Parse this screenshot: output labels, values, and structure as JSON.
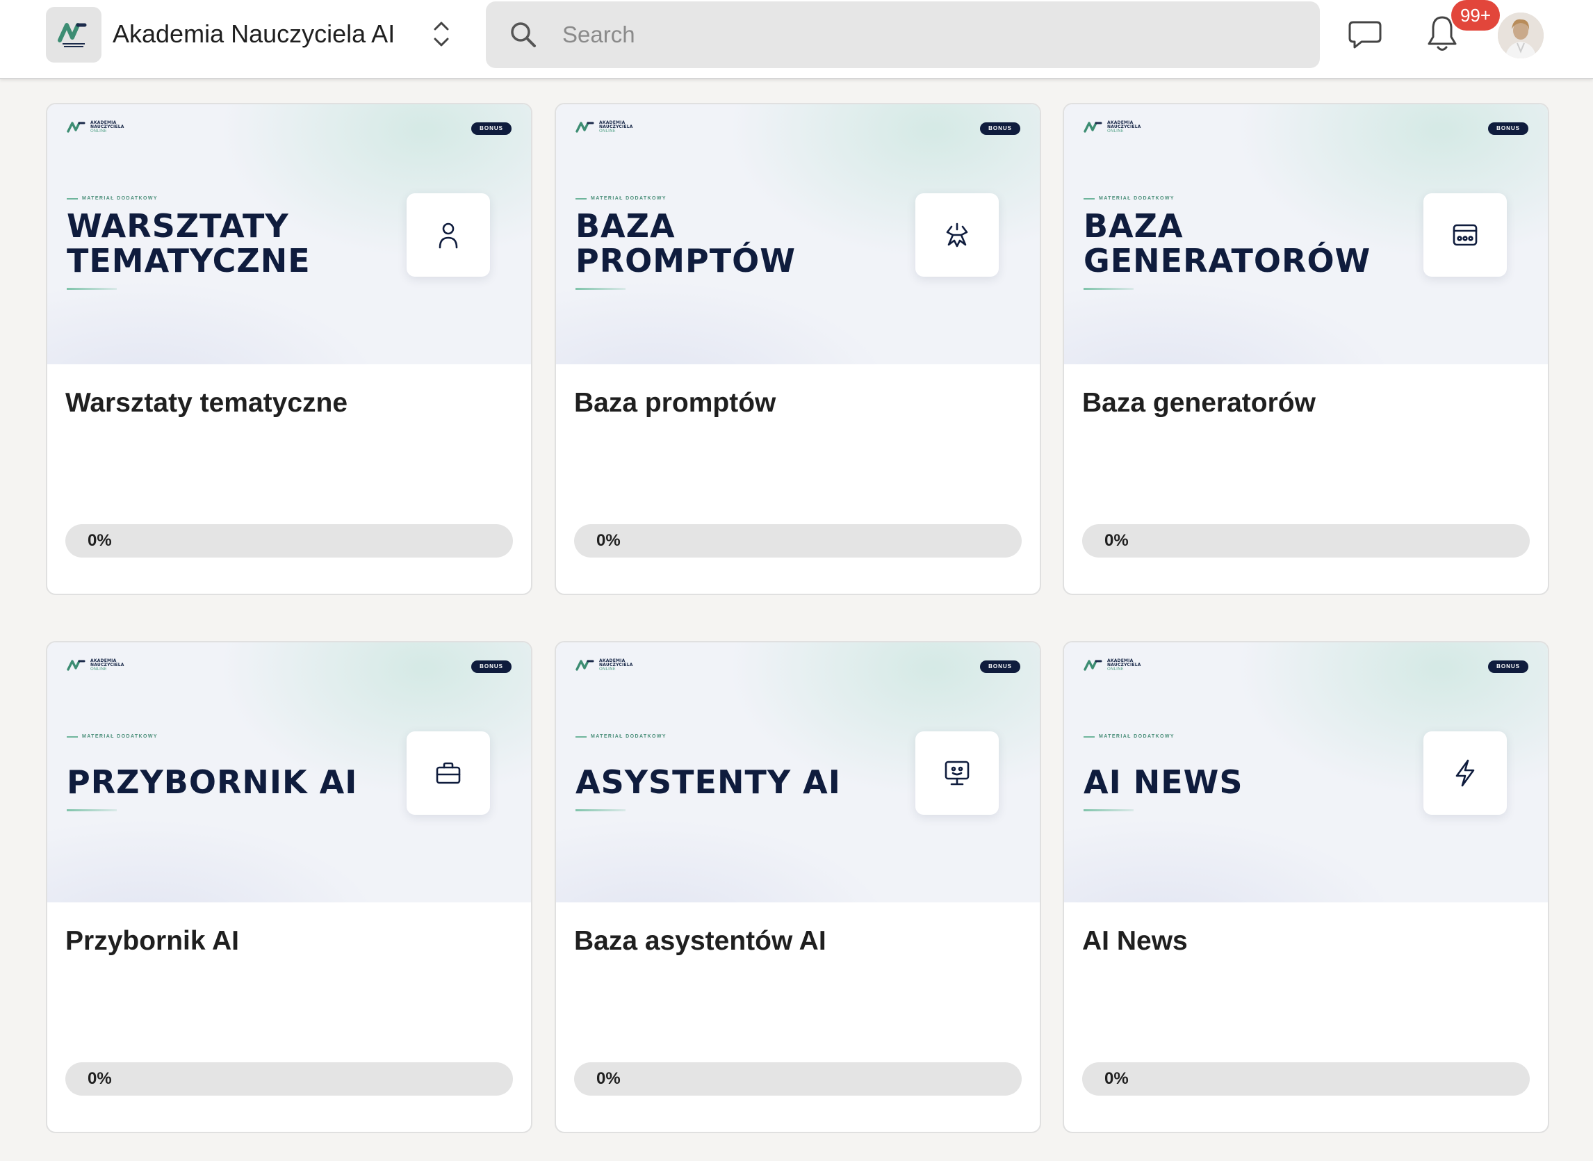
{
  "header": {
    "title": "Akademia Nauczyciela AI",
    "logo_icon": "akademia-logo",
    "switcher_icon": "chevron-up-down-icon",
    "search": {
      "placeholder": "Search",
      "value": ""
    },
    "chat_icon": "chat-bubble-icon",
    "bell_icon": "bell-icon",
    "notification_count": "99+",
    "avatar_icon": "user-avatar"
  },
  "card_common": {
    "logo_text": [
      "AKADEMIA",
      "NAUCZYCIELA",
      "ONLINE"
    ],
    "bonus_label": "BONUS",
    "kicker": "MATERIAŁ DODATKOWY"
  },
  "cards": [
    {
      "banner_title": "WARSZTATY\nTEMATYCZNE",
      "icon": "person-icon",
      "title": "Warsztaty tematyczne",
      "progress": 0,
      "progress_label": "0%"
    },
    {
      "banner_title": "BAZA\nPROMPTÓW",
      "icon": "ai-spark-icon",
      "title": "Baza promptów",
      "progress": 0,
      "progress_label": "0%"
    },
    {
      "banner_title": "BAZA\nGENERATORÓW",
      "icon": "generator-window-icon",
      "title": "Baza generatorów",
      "progress": 0,
      "progress_label": "0%"
    },
    {
      "banner_title": "PRZYBORNIK AI",
      "icon": "briefcase-icon",
      "title": "Przybornik AI",
      "progress": 0,
      "progress_label": "0%"
    },
    {
      "banner_title": "ASYSTENTY AI",
      "icon": "monitor-bot-icon",
      "title": "Baza asystentów AI",
      "progress": 0,
      "progress_label": "0%"
    },
    {
      "banner_title": "AI NEWS",
      "icon": "lightning-icon",
      "title": "AI News",
      "progress": 0,
      "progress_label": "0%"
    }
  ],
  "colors": {
    "accent": "#3d8d73",
    "navy": "#0f1c3d",
    "badge": "#e2463b",
    "background": "#f5f4f2"
  }
}
